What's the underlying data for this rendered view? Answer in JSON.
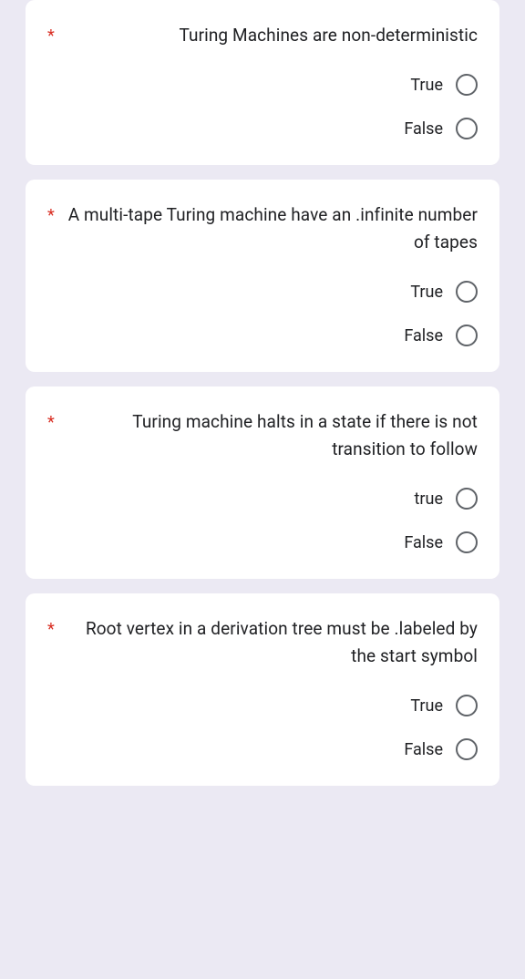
{
  "required_marker": "*",
  "questions": [
    {
      "text": "Turing Machines are non-deterministic",
      "options": [
        "True",
        "False"
      ]
    },
    {
      "text": "A multi-tape Turing machine have an .infinite number of tapes",
      "options": [
        "True",
        "False"
      ]
    },
    {
      "text": "Turing machine halts in a state if there is not transition to follow",
      "options": [
        "true",
        "False"
      ]
    },
    {
      "text": "Root vertex in a derivation tree must be .labeled by the start symbol",
      "options": [
        "True",
        "False"
      ]
    }
  ]
}
